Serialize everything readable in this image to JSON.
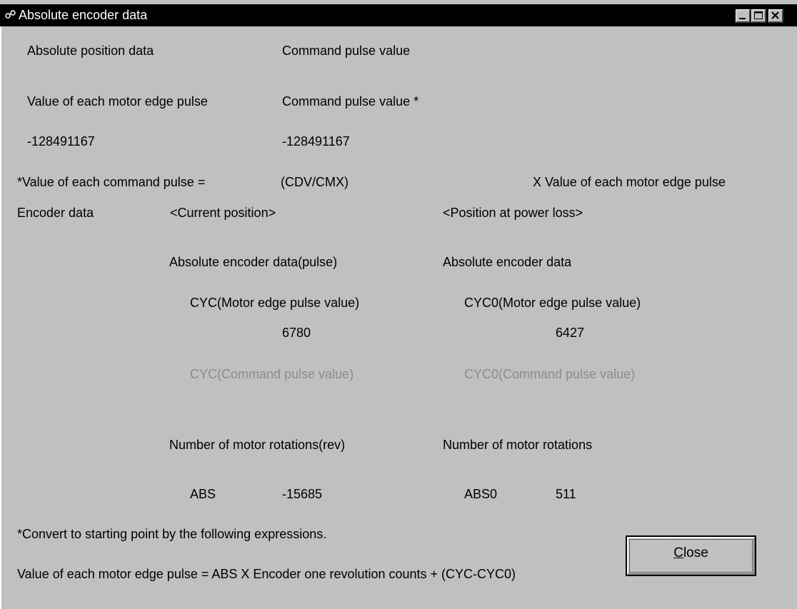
{
  "window": {
    "title": "Absolute encoder data",
    "controls": [
      "minimize",
      "maximize",
      "close"
    ]
  },
  "header": {
    "abs_position_label": "Absolute position data",
    "cmd_pulse_label": "Command pulse value",
    "motor_edge_label": "Value of each motor edge pulse",
    "cmd_pulse_star_label": "Command pulse value *",
    "motor_edge_value": "-128491167",
    "cmd_pulse_value": "-128491167"
  },
  "formula": {
    "left": "*Value of each command pulse =",
    "middle": "(CDV/CMX)",
    "right": "X  Value of each motor edge pulse"
  },
  "encoder": {
    "label": "Encoder data",
    "current_heading": "<Current position>",
    "powerloss_heading": "<Position at power loss>",
    "current_abs_enc_label": "Absolute encoder data(pulse)",
    "powerloss_abs_enc_label": "Absolute encoder data",
    "cyc_motor_label": "CYC(Motor edge pulse value)",
    "cyc0_motor_label": "CYC0(Motor edge pulse value)",
    "cyc_motor_value": "6780",
    "cyc0_motor_value": "6427",
    "cyc_cmd_label": "CYC(Command pulse value)",
    "cyc0_cmd_label": "CYC0(Command pulse value)",
    "rot_current_label": "Number of motor rotations(rev)",
    "rot_powerloss_label": "Number of motor rotations",
    "abs_label": "ABS",
    "abs_value": "-15685",
    "abs0_label": "ABS0",
    "abs0_value": "511"
  },
  "footer": {
    "note": "*Convert to starting point by the following expressions.",
    "expression": "Value of each motor edge pulse =  ABS X Encoder one revolution counts + (CYC-CYC0)"
  },
  "buttons": {
    "close_label": "Close"
  },
  "colors": {
    "face": "#c0c0c0",
    "titlebar": "#000000",
    "disabled_text": "#8c8c8c"
  }
}
